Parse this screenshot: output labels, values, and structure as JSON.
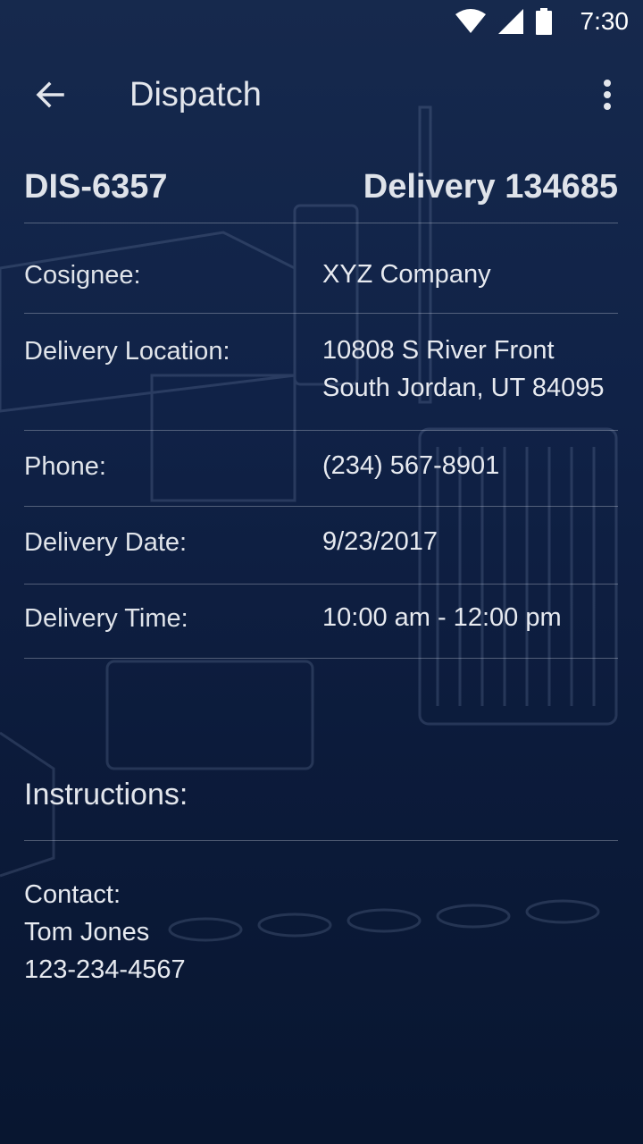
{
  "status_bar": {
    "time": "7:30",
    "icons": [
      "wifi-icon",
      "cell-signal-icon",
      "battery-icon"
    ]
  },
  "app_bar": {
    "title": "Dispatch",
    "back_icon": "arrow-left-icon",
    "menu_icon": "more-vert-icon"
  },
  "dispatch": {
    "id": "DIS-6357",
    "delivery": "Delivery 134685"
  },
  "details": [
    {
      "label": "Cosignee:",
      "value_lines": [
        "XYZ Company"
      ]
    },
    {
      "label": "Delivery Location:",
      "value_lines": [
        "10808 S River Front",
        "South Jordan, UT 84095"
      ]
    },
    {
      "label": "Phone:",
      "value_lines": [
        "(234) 567-8901"
      ]
    },
    {
      "label": "Delivery Date:",
      "value_lines": [
        "9/23/2017"
      ]
    },
    {
      "label": "Delivery Time:",
      "value_lines": [
        "10:00 am - 12:00 pm"
      ]
    }
  ],
  "instructions": {
    "title": "Instructions:"
  },
  "contact": {
    "label": "Contact:",
    "name": "Tom Jones",
    "phone": "123-234-4567"
  },
  "colors": {
    "background_top": "#16294d",
    "background_bottom": "#081630",
    "text": "#e6e9ef"
  }
}
